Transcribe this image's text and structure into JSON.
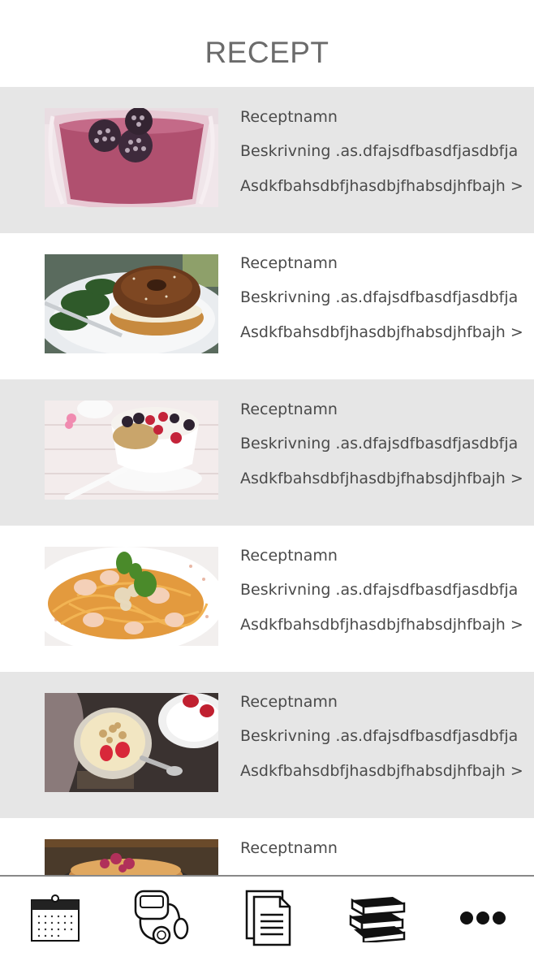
{
  "header": {
    "title": "RECEPT"
  },
  "recipes": [
    {
      "name": "Receptnamn",
      "description": "Beskrivning .as.dfajsdfbasdfjasdbfja",
      "more": "Asdkfbahsdbfjhasdbjfhabsdjhfbajh >",
      "image": "berry-smoothie"
    },
    {
      "name": "Receptnamn",
      "description": "Beskrivning .as.dfajsdfbasdfjasdbfja",
      "more": "Asdkfbahsdbfjhasdbjfhabsdjhfbajh >",
      "image": "bagel-sandwich"
    },
    {
      "name": "Receptnamn",
      "description": "Beskrivning .as.dfajsdfbasdfjasdbfja",
      "more": "Asdkfbahsdbfjhasdbjfhabsdjhfbajh >",
      "image": "yogurt-granola-bowl"
    },
    {
      "name": "Receptnamn",
      "description": "Beskrivning .as.dfajsdfbasdfjasdbfja",
      "more": "Asdkfbahsdbfjhasdbjfhabsdjhfbajh >",
      "image": "shrimp-pasta"
    },
    {
      "name": "Receptnamn",
      "description": "Beskrivning .as.dfajsdfbasdfjasdbfja",
      "more": "Asdkfbahsdbfjhasdbjfhabsdjhfbajh >",
      "image": "yogurt-strawberries"
    },
    {
      "name": "Receptnamn",
      "description": "",
      "more": "",
      "image": "pancakes"
    }
  ],
  "tabbar": {
    "items": [
      {
        "icon": "calendar-icon"
      },
      {
        "icon": "blood-pressure-icon"
      },
      {
        "icon": "document-icon"
      },
      {
        "icon": "books-icon"
      },
      {
        "icon": "more-icon"
      }
    ]
  },
  "colors": {
    "row_shade": "#e6e6e6",
    "row_plain": "#ffffff",
    "text": "#4a4a4a",
    "title": "#6b6b6b"
  }
}
